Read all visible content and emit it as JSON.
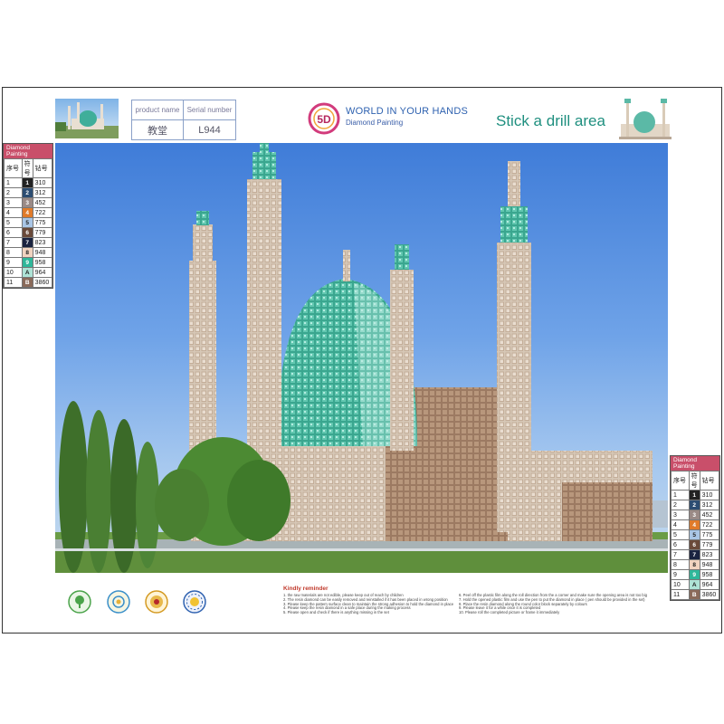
{
  "header": {
    "product_name_label": "product name",
    "serial_number_label": "Serial number",
    "product_name": "教堂",
    "serial_number": "L944",
    "logo_text": "5D",
    "brand_title": "WORLD IN YOUR HANDS",
    "brand_subtitle": "Diamond Painting",
    "stick_area": "Stick a drill area"
  },
  "legend": {
    "title_line1": "Diamond",
    "title_line2": "Painting",
    "col_index": "序号",
    "col_symbol": "符号",
    "col_code": "钻号",
    "rows": [
      {
        "index": "1",
        "symbol": "1",
        "code": "310",
        "color": "#222222"
      },
      {
        "index": "2",
        "symbol": "2",
        "code": "312",
        "color": "#2c4d72"
      },
      {
        "index": "3",
        "symbol": "3",
        "code": "452",
        "color": "#9a8a86"
      },
      {
        "index": "4",
        "symbol": "4",
        "code": "722",
        "color": "#e07b2a"
      },
      {
        "index": "5",
        "symbol": "5",
        "code": "775",
        "color": "#a9c6e6"
      },
      {
        "index": "6",
        "symbol": "6",
        "code": "779",
        "color": "#6a4a3a"
      },
      {
        "index": "7",
        "symbol": "7",
        "code": "823",
        "color": "#1a2340"
      },
      {
        "index": "8",
        "symbol": "8",
        "code": "948",
        "color": "#f1d3c0"
      },
      {
        "index": "9",
        "symbol": "9",
        "code": "958",
        "color": "#2fb79a"
      },
      {
        "index": "10",
        "symbol": "A",
        "code": "964",
        "color": "#aee3d6"
      },
      {
        "index": "11",
        "symbol": "B",
        "code": "3860",
        "color": "#8a6a5a"
      }
    ]
  },
  "reminder": {
    "title": "Kindly reminder",
    "col1": [
      "1. the raw materials are not edible, please keep out of reach by children",
      "2. The resin diamond can be easily removed and reinstalled if it has been placed in wrong position",
      "3. Please keep the pattern surface clean to maintain the strong adhesion  to hold the diamond in place",
      "4. Please keep the resin diamond in a safe place during the making process",
      "5. Please open and check if there is anything missing in the set"
    ],
    "col2": [
      "6. Peel off the plastic film along the roll direction from the a corner and make sure the opening area is not too big",
      "7. Hold the opened plastic film and use the pen to put the diamond in place ( pen should be provided in the set)",
      "8. Place the resin diamond along the round color block separately by colours",
      "9. Please leave it for a while once it is completed",
      "10. Please roll the completed picture or frame it immediately"
    ]
  },
  "colors": {
    "accent_teal": "#1f8f7f",
    "brand_blue": "#2f62b0",
    "legend_header": "#c94f6a",
    "reminder_red": "#c0392b"
  }
}
